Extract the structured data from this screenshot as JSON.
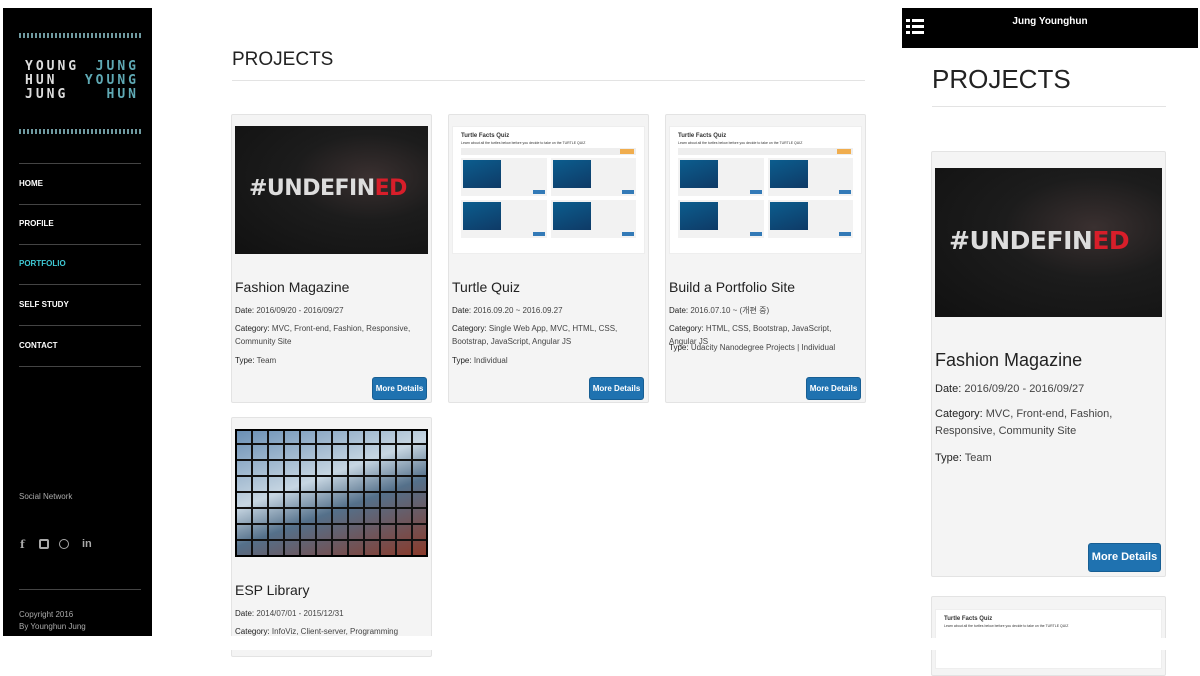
{
  "sidebar": {
    "logo_white": [
      "YOUNG",
      "HUN",
      "JUNG"
    ],
    "logo_cyan": [
      "JUNG",
      "YOUNG",
      "HUN"
    ],
    "nav": [
      {
        "label": "HOME"
      },
      {
        "label": "PROFILE"
      },
      {
        "label": "PORTFOLIO",
        "active": true
      },
      {
        "label": "SELF STUDY"
      },
      {
        "label": "CONTACT"
      }
    ],
    "social_title": "Social Network",
    "social_icons": [
      "facebook-icon",
      "instagram-icon",
      "pinterest-icon",
      "linkedin-icon"
    ],
    "copyright": "Copyright 2016",
    "author": "By Younghun Jung",
    "accent": "#3fc8d4"
  },
  "main": {
    "title": "PROJECTS",
    "more": "More Details",
    "projects": [
      {
        "title": "Fashion Magazine",
        "date_label": "Date:",
        "date": "2016/09/20 - 2016/09/27",
        "cat_label": "Category:",
        "category": "MVC, Front-end, Fashion, Responsive, Community Site",
        "type_label": "Type:",
        "type": "Team",
        "thumb_text": "#UNDEFIN",
        "thumb_red": "ED"
      },
      {
        "title": "Turtle Quiz",
        "date_label": "Date:",
        "date": "2016.09.20 ~ 2016.09.27",
        "cat_label": "Category:",
        "category": "Single Web App, MVC, HTML, CSS, Bootstrap, JavaScript, Angular JS",
        "type_label": "Type:",
        "type": "Individual",
        "quiz_title": "Turtle Facts Quiz",
        "quiz_sub": "Learn about all the turtles below before you decide to take on the TURTLE QUIZ"
      },
      {
        "title": "Build a Portfolio Site",
        "date_label": "Date:",
        "date": "2016.07.10 ~ (개편 중)",
        "cat_label": "Category:",
        "category": "HTML, CSS, Bootstrap, JavaScript, Angular JS",
        "type_label": "Type:",
        "type": "Udacity Nanodegree Projects | Individual",
        "quiz_title": "Turtle Facts Quiz",
        "quiz_sub": "Learn about all the turtles below before you decide to take on the TURTLE QUIZ"
      },
      {
        "title": "ESP Library",
        "date_label": "Date:",
        "date": "2014/07/01 - 2015/12/31",
        "cat_label": "Category:",
        "category": "InfoViz, Client-server, Programming Interface,"
      }
    ]
  },
  "mobile": {
    "header": "Jung Younghun",
    "menu_icon": "list-icon",
    "title": "PROJECTS"
  }
}
